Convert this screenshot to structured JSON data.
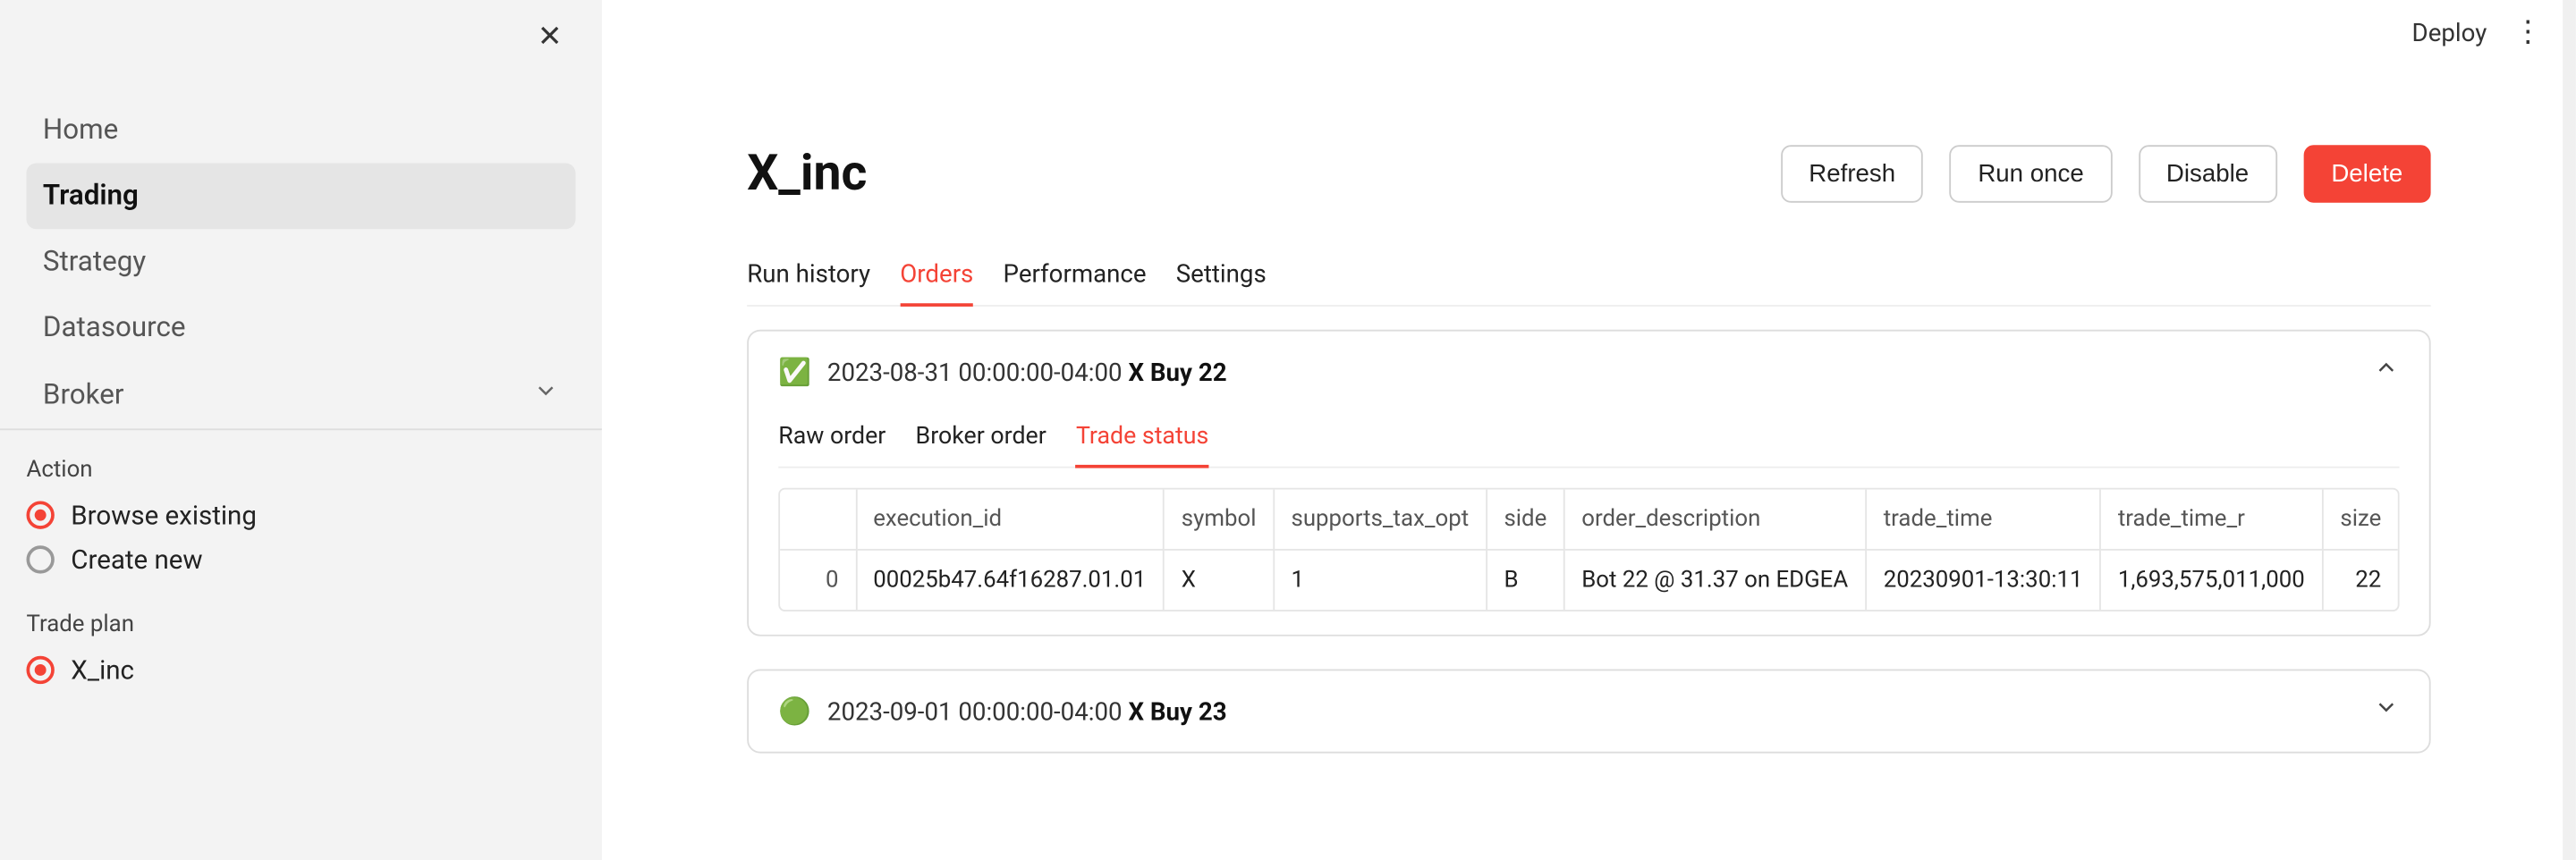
{
  "topbar": {
    "deploy": "Deploy"
  },
  "sidebar": {
    "nav": {
      "home": "Home",
      "trading": "Trading",
      "strategy": "Strategy",
      "datasource": "Datasource",
      "broker": "Broker"
    },
    "action_label": "Action",
    "action_browse": "Browse existing",
    "action_create": "Create new",
    "tradeplan_label": "Trade plan",
    "tradeplan_item": "X_inc"
  },
  "header": {
    "title": "X_inc",
    "refresh": "Refresh",
    "run_once": "Run once",
    "disable": "Disable",
    "delete": "Delete"
  },
  "tabs": {
    "run_history": "Run history",
    "orders": "Orders",
    "performance": "Performance",
    "settings": "Settings"
  },
  "card1": {
    "emoji": "✅",
    "timestamp": "2023-08-31 00:00:00-04:00",
    "bold": "X Buy 22",
    "subtabs": {
      "raw": "Raw order",
      "broker": "Broker order",
      "trade": "Trade status"
    },
    "cols": {
      "idx": "",
      "execution_id": "execution_id",
      "symbol": "symbol",
      "supports_tax_opt": "supports_tax_opt",
      "side": "side",
      "order_description": "order_description",
      "trade_time": "trade_time",
      "trade_time_r": "trade_time_r",
      "size": "size"
    },
    "row": {
      "idx": "0",
      "execution_id": "00025b47.64f16287.01.01",
      "symbol": "X",
      "supports_tax_opt": "1",
      "side": "B",
      "order_description": "Bot 22 @ 31.37 on EDGEA",
      "trade_time": "20230901-13:30:11",
      "trade_time_r": "1,693,575,011,000",
      "size": "22"
    }
  },
  "card2": {
    "emoji": "🟢",
    "timestamp": "2023-09-01 00:00:00-04:00",
    "bold": "X Buy 23"
  }
}
